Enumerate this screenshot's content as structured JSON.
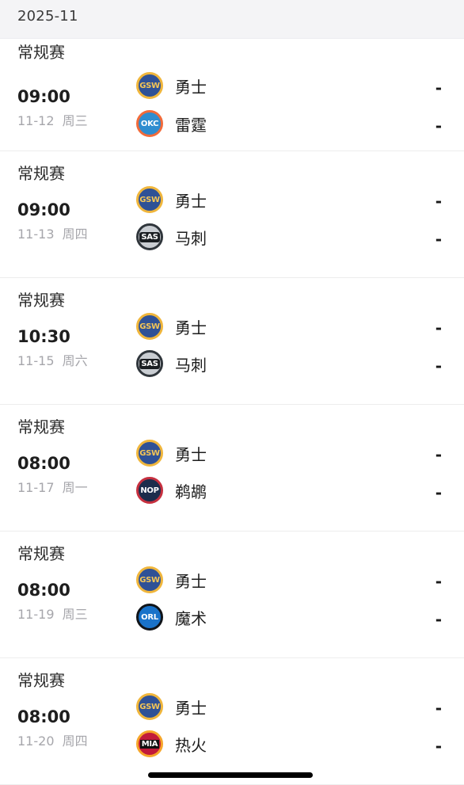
{
  "month": "2025-11",
  "games": [
    {
      "type": "常规赛",
      "time": "09:00",
      "date": "11-12",
      "weekday": "周三",
      "home": {
        "abbr": "GSW",
        "logo": "gsw-logo-icon",
        "name": "勇士",
        "score": "-"
      },
      "away": {
        "abbr": "OKC",
        "logo": "okc-logo-icon",
        "name": "雷霆",
        "score": "-"
      }
    },
    {
      "type": "常规赛",
      "time": "09:00",
      "date": "11-13",
      "weekday": "周四",
      "home": {
        "abbr": "GSW",
        "logo": "gsw-logo-icon",
        "name": "勇士",
        "score": "-"
      },
      "away": {
        "abbr": "SAS",
        "logo": "sas-logo-icon",
        "name": "马刺",
        "score": "-"
      }
    },
    {
      "type": "常规赛",
      "time": "10:30",
      "date": "11-15",
      "weekday": "周六",
      "home": {
        "abbr": "GSW",
        "logo": "gsw-logo-icon",
        "name": "勇士",
        "score": "-"
      },
      "away": {
        "abbr": "SAS",
        "logo": "sas-logo-icon",
        "name": "马刺",
        "score": "-"
      }
    },
    {
      "type": "常规赛",
      "time": "08:00",
      "date": "11-17",
      "weekday": "周一",
      "home": {
        "abbr": "GSW",
        "logo": "gsw-logo-icon",
        "name": "勇士",
        "score": "-"
      },
      "away": {
        "abbr": "NOP",
        "logo": "nop-logo-icon",
        "name": "鹈鹕",
        "score": "-"
      }
    },
    {
      "type": "常规赛",
      "time": "08:00",
      "date": "11-19",
      "weekday": "周三",
      "home": {
        "abbr": "GSW",
        "logo": "gsw-logo-icon",
        "name": "勇士",
        "score": "-"
      },
      "away": {
        "abbr": "ORL",
        "logo": "orl-logo-icon",
        "name": "魔术",
        "score": "-"
      }
    },
    {
      "type": "常规赛",
      "time": "08:00",
      "date": "11-20",
      "weekday": "周四",
      "home": {
        "abbr": "GSW",
        "logo": "gsw-logo-icon",
        "name": "勇士",
        "score": "-"
      },
      "away": {
        "abbr": "MIA",
        "logo": "mia-logo-icon",
        "name": "热火",
        "score": "-"
      }
    }
  ]
}
